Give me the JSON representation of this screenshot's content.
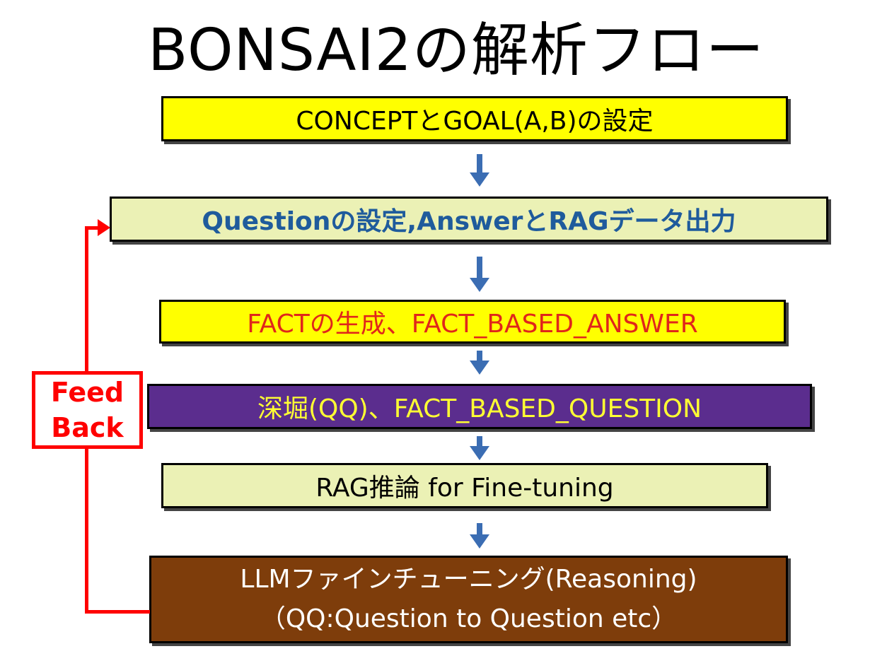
{
  "title": "BONSAI2の解析フロー",
  "steps": [
    {
      "label": "CONCEPTとGOAL(A,B)の設定"
    },
    {
      "label": "Questionの設定,AnswerとRAGデータ出力"
    },
    {
      "label": "FACTの生成、FACT_BASED_ANSWER"
    },
    {
      "label": "深堀(QQ)、FACT_BASED_QUESTION"
    },
    {
      "label": "RAG推論 for Fine-tuning"
    },
    {
      "line1": "LLMファインチューニング(Reasoning)",
      "line2": "（QQ:Question to Question etc）"
    }
  ],
  "feedback": {
    "line1": "Feed",
    "line2": "Back"
  },
  "colors": {
    "arrow": "#3b6db3",
    "feedback": "#ff0000",
    "yellow": "#ffff00",
    "pale": "#ebf1b5",
    "purple": "#5b2d8e",
    "brown": "#7e3d0b"
  }
}
